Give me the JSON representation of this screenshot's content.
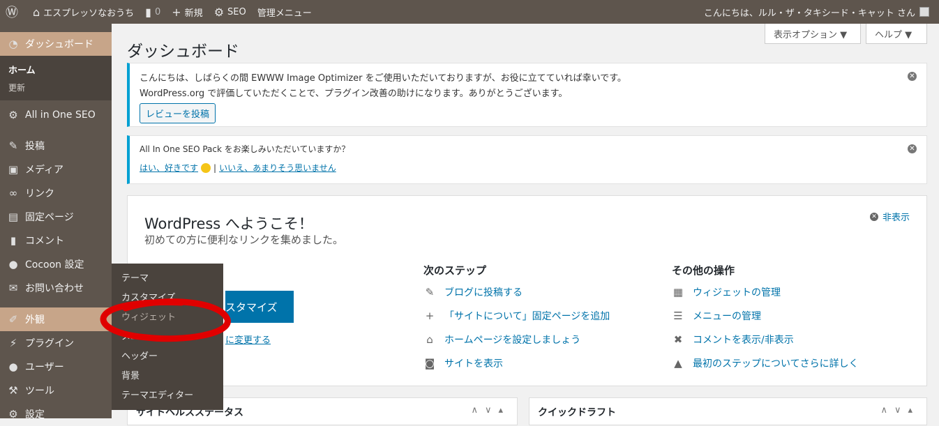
{
  "adminbar": {
    "site_name": "エスプレッソなおうち",
    "comments_count": "0",
    "new_label": "新規",
    "seo_label": "SEO",
    "admin_menu_label": "管理メニュー",
    "greeting": "こんにちは、ルル・ザ・タキシード・キャット さん"
  },
  "sidebar": {
    "dashboard": "ダッシュボード",
    "home": "ホーム",
    "update": "更新",
    "aioseo": "All in One SEO",
    "posts": "投稿",
    "media": "メディア",
    "links": "リンク",
    "pages": "固定ページ",
    "comments": "コメント",
    "cocoon": "Cocoon 設定",
    "contact": "お問い合わせ",
    "appearance": "外観",
    "plugins": "プラグイン",
    "users": "ユーザー",
    "tools": "ツール",
    "settings": "設定"
  },
  "flyout": {
    "items": [
      "テーマ",
      "カスタマイズ",
      "ウィジェット",
      "メニュー",
      "ヘッダー",
      "背景",
      "テーマエディター"
    ]
  },
  "main": {
    "screen_options": "表示オプション ▼",
    "help": "ヘルプ ▼",
    "title": "ダッシュボード",
    "notice1_line1": "こんにちは、しばらくの間 EWWW Image Optimizer をご使用いただいておりますが、お役に立てていれば幸いです。",
    "notice1_line2": "WordPress.org で評価していただくことで、プラグイン改善の助けになります。ありがとうございます。",
    "review_button": "レビューを投稿",
    "notice2_line1": "All In One SEO Pack をお楽しみいただいていますか？",
    "notice2_yes": "はい、好きです",
    "notice2_sep": "|",
    "notice2_no": "いいえ、あまりそう思いません",
    "welcome_title": "WordPress へようこそ！",
    "welcome_sub": "初めての方に便利なリンクを集めました。",
    "hide": "非表示",
    "customize_btn": "スタマイズ",
    "change_link": "に変更する",
    "next_steps_h": "次のステップ",
    "next_steps": [
      "ブログに投稿する",
      "「サイトについて」固定ページを追加",
      "ホームページを設定しましょう",
      "サイトを表示"
    ],
    "more_actions_h": "その他の操作",
    "more_actions": [
      "ウィジェットの管理",
      "メニューの管理",
      "コメントを表示/非表示",
      "最初のステップについてさらに詳しく"
    ],
    "box_left": "サイトヘルスステータス",
    "box_right": "クイックドラフト"
  },
  "colors": {
    "accent": "#c7a589",
    "bar": "#5e554d",
    "link": "#0073aa",
    "annotation": "#e00000"
  }
}
